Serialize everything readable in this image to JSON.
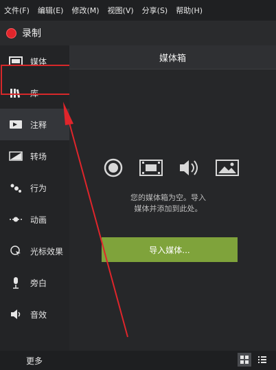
{
  "menu": [
    "文件(F)",
    "编辑(E)",
    "修改(M)",
    "视图(V)",
    "分享(S)",
    "帮助(H)"
  ],
  "record": {
    "label": "录制"
  },
  "sidebar": {
    "items": [
      {
        "label": "媒体",
        "icon": "media-bin-icon"
      },
      {
        "label": "库",
        "icon": "library-icon"
      },
      {
        "label": "注释",
        "icon": "annotations-icon"
      },
      {
        "label": "转场",
        "icon": "transitions-icon"
      },
      {
        "label": "行为",
        "icon": "behaviors-icon"
      },
      {
        "label": "动画",
        "icon": "animations-icon"
      },
      {
        "label": "光标效果",
        "icon": "cursor-effects-icon"
      },
      {
        "label": "旁白",
        "icon": "narration-icon"
      },
      {
        "label": "音效",
        "icon": "audio-effects-icon"
      }
    ],
    "more_label": "更多",
    "add_label": "+"
  },
  "panel": {
    "title": "媒体箱",
    "hint_line1": "您的媒体箱为空。导入",
    "hint_line2": "媒体并添加到此处。",
    "import_label": "导入媒体..."
  },
  "colors": {
    "record": "#e0252b",
    "import": "#7fa33b",
    "highlight": "#d8282a"
  }
}
